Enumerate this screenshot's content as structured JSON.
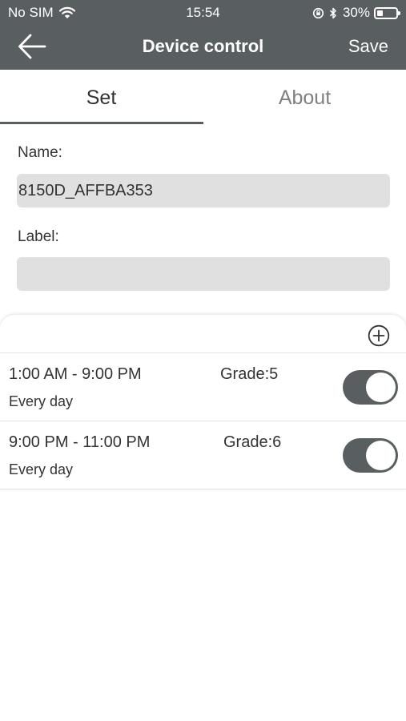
{
  "status_bar": {
    "carrier": "No SIM",
    "time": "15:54",
    "battery": "30%",
    "battery_level": 0.3,
    "icons": [
      "wifi-icon",
      "rotation-lock-icon",
      "bluetooth-icon",
      "battery-icon"
    ]
  },
  "nav": {
    "back_icon": "arrow-left-icon",
    "title": "Device control",
    "save_label": "Save"
  },
  "tabs": [
    {
      "label": "Set",
      "active": true
    },
    {
      "label": "About",
      "active": false
    }
  ],
  "form": {
    "name_label": "Name:",
    "name_value": "8150D_AFFBA353",
    "label_label": "Label:",
    "label_value": ""
  },
  "schedules": {
    "add_icon": "plus-circle-icon",
    "items": [
      {
        "time": "1:00 AM - 9:00 PM",
        "grade": "Grade:5",
        "repeat": "Every day",
        "enabled": true
      },
      {
        "time": "9:00 PM - 11:00 PM",
        "grade": "Grade:6",
        "repeat": "Every day",
        "enabled": true
      }
    ]
  },
  "colors": {
    "header_bg": "#595e61",
    "input_bg": "#e0e0e0",
    "toggle_on": "#595e61"
  }
}
